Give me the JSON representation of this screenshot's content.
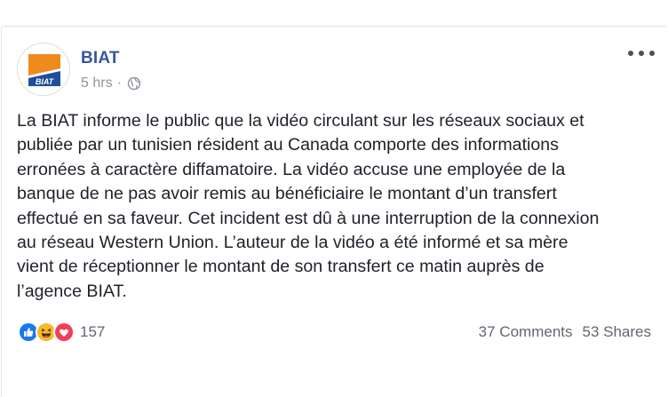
{
  "post": {
    "page_name": "BIAT",
    "timestamp": "5 hrs",
    "separator": "·",
    "privacy_icon": "globe-icon",
    "avatar_logo_text": "BIAT",
    "text": "La BIAT informe le public que la vidéo circulant sur les réseaux sociaux et\npubliée par un tunisien résident au Canada comporte des informations\nerronées à caractère diffamatoire. La vidéo accuse une employée de la\nbanque de ne pas avoir remis au bénéficiaire le montant d’un transfert\neffectué en sa faveur. Cet incident est dû à une interruption de la connexion\nau réseau Western Union. L’auteur de la vidéo a été informé et sa mère\nvient de réceptionner le montant de son transfert ce matin auprès de\nl’agence BIAT."
  },
  "reactions": {
    "icons": [
      "like-icon",
      "haha-icon",
      "love-icon"
    ],
    "count": "157"
  },
  "engagement": {
    "comments": "37 Comments",
    "shares": "53 Shares"
  },
  "colors": {
    "page_name": "#365899",
    "meta_text": "#90949c",
    "body_text": "#1d2129",
    "like_blue": "#1877f2",
    "haha_yellow": "#f7b928",
    "love_red": "#f33e58",
    "logo_orange": "#f08a1c",
    "logo_blue": "#1f4e9a"
  }
}
